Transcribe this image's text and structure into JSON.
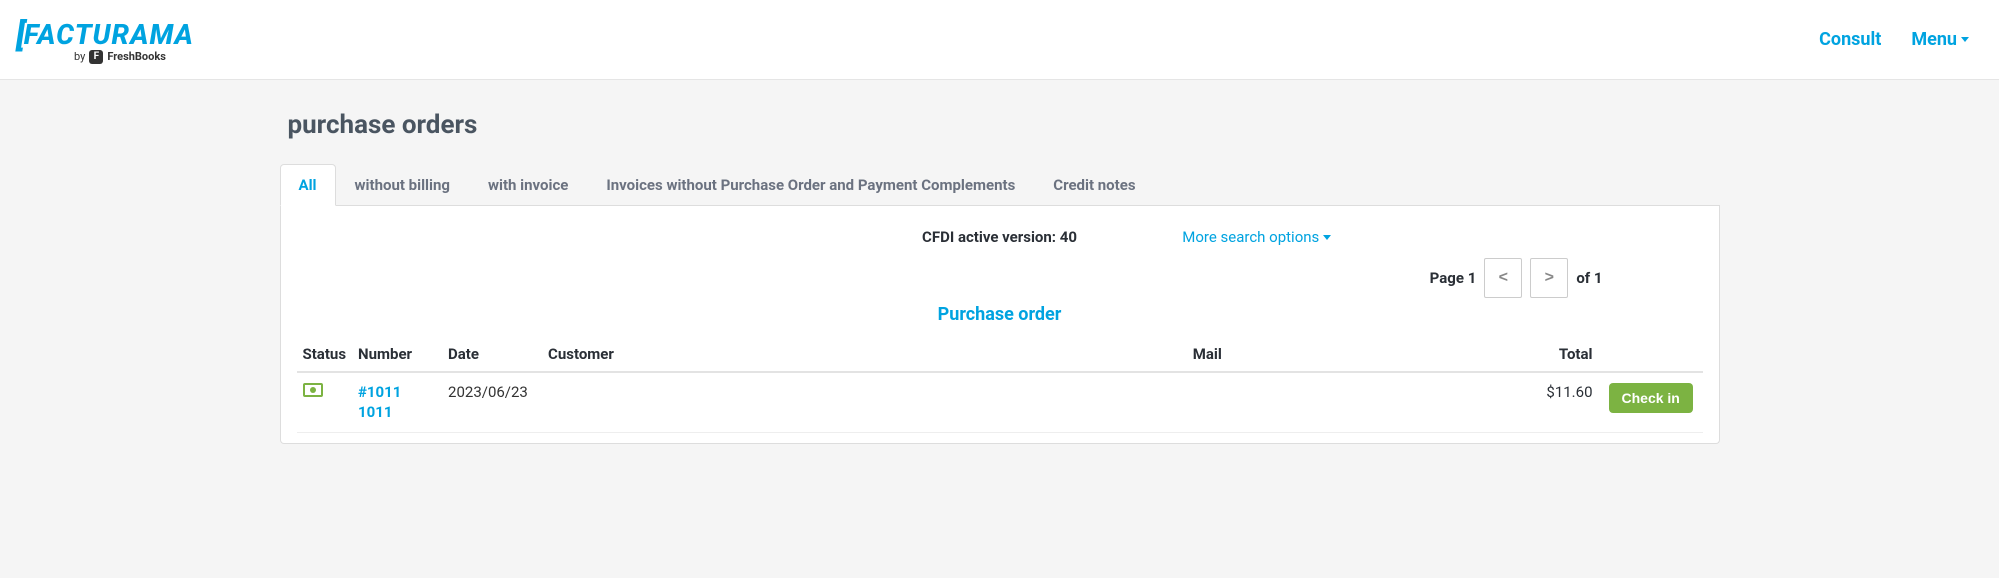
{
  "logo": {
    "main": "FACTURAMA",
    "by": "by",
    "subbrand": "FreshBooks",
    "sub_initial": "F"
  },
  "nav": {
    "consult": "Consult",
    "menu": "Menu"
  },
  "page": {
    "title": "purchase orders"
  },
  "tabs": {
    "all": "All",
    "without_billing": "without billing",
    "with_invoice": "with invoice",
    "no_po_complements": "Invoices without Purchase Order and Payment Complements",
    "credit_notes": "Credit notes"
  },
  "cfdi": {
    "label": "CFDI active version: 40"
  },
  "more_options": "More search options",
  "pager": {
    "page_label_prefix": "Page",
    "page_current": "1",
    "of": "of",
    "total_pages": "1",
    "prev": "<",
    "next": ">"
  },
  "table": {
    "title": "Purchase order",
    "headers": {
      "status": "Status",
      "number": "Number",
      "date": "Date",
      "customer": "Customer",
      "mail": "Mail",
      "total": "Total"
    },
    "rows": [
      {
        "number_line1": "#1011",
        "number_line2": "1011",
        "date": "2023/06/23",
        "customer": "",
        "mail": "",
        "total": "$11.60",
        "action": "Check in"
      }
    ]
  }
}
